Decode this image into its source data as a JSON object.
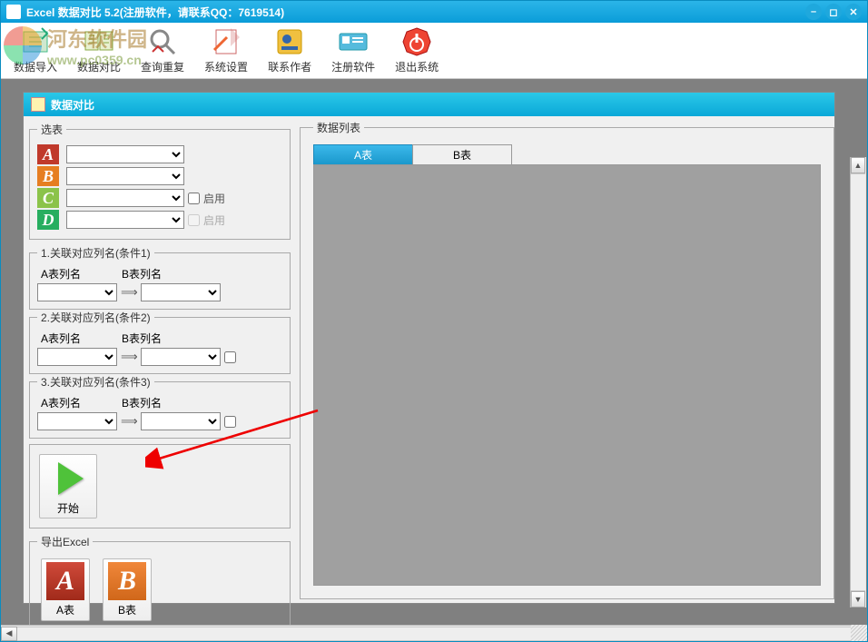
{
  "window": {
    "title": "Excel 数据对比  5.2(注册软件，请联系QQ：7619514)"
  },
  "toolbar": {
    "items": [
      {
        "label": "数据导入",
        "icon": "import"
      },
      {
        "label": "数据对比",
        "icon": "compare"
      },
      {
        "label": "查询重复",
        "icon": "duplicate"
      },
      {
        "label": "系统设置",
        "icon": "settings"
      },
      {
        "label": "联系作者",
        "icon": "contact"
      },
      {
        "label": "注册软件",
        "icon": "register"
      },
      {
        "label": "退出系统",
        "icon": "exit"
      }
    ]
  },
  "inner": {
    "title": "数据对比"
  },
  "select_tables": {
    "legend": "选表",
    "rows": [
      {
        "letter": "A",
        "cls": "lb-a",
        "enable_label": "",
        "show_enable": false
      },
      {
        "letter": "B",
        "cls": "lb-b",
        "enable_label": "",
        "show_enable": false
      },
      {
        "letter": "C",
        "cls": "lb-c",
        "enable_label": "启用",
        "show_enable": true,
        "disabled": false
      },
      {
        "letter": "D",
        "cls": "lb-d",
        "enable_label": "启用",
        "show_enable": true,
        "disabled": true
      }
    ]
  },
  "conditions": [
    {
      "legend": "1.关联对应列名(条件1)",
      "a_label": "A表列名",
      "b_label": "B表列名",
      "show_chk": false
    },
    {
      "legend": "2.关联对应列名(条件2)",
      "a_label": "A表列名",
      "b_label": "B表列名",
      "show_chk": true
    },
    {
      "legend": "3.关联对应列名(条件3)",
      "a_label": "A表列名",
      "b_label": "B表列名",
      "show_chk": true
    }
  ],
  "start": {
    "label": "开始"
  },
  "export": {
    "legend": "导出Excel",
    "a_label": "A表",
    "b_label": "B表"
  },
  "data_list": {
    "legend": "数据列表",
    "tabs": [
      {
        "label": "A表",
        "active": true
      },
      {
        "label": "B表",
        "active": false
      }
    ]
  },
  "watermark": {
    "text1": "河东软件园",
    "text2": "www.pc0359.cn"
  }
}
